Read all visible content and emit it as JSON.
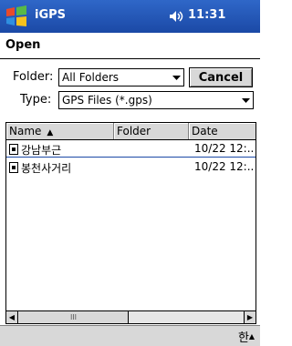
{
  "titlebar": {
    "app_name": "iGPS",
    "time": "11:31",
    "icons": [
      "windows-start-icon",
      "speaker-icon"
    ]
  },
  "dialog": {
    "title": "Open",
    "folder_label": "Folder:",
    "folder_value": "All Folders",
    "cancel_label": "Cancel",
    "type_label": "Type:",
    "type_value": "GPS Files (*.gps)"
  },
  "list": {
    "columns": [
      "Name",
      "Folder",
      "Date"
    ],
    "sort_indicator": "▲",
    "rows": [
      {
        "name": "강남부근",
        "folder": "",
        "date": "10/22 12:.."
      },
      {
        "name": "봉천사거리",
        "folder": "",
        "date": "10/22 12:.."
      }
    ]
  },
  "scrollbar": {
    "left_arrow": "◀",
    "right_arrow": "▶",
    "thumb_grip": "III"
  },
  "input_panel": {
    "label": "한",
    "arrow": "▲"
  }
}
